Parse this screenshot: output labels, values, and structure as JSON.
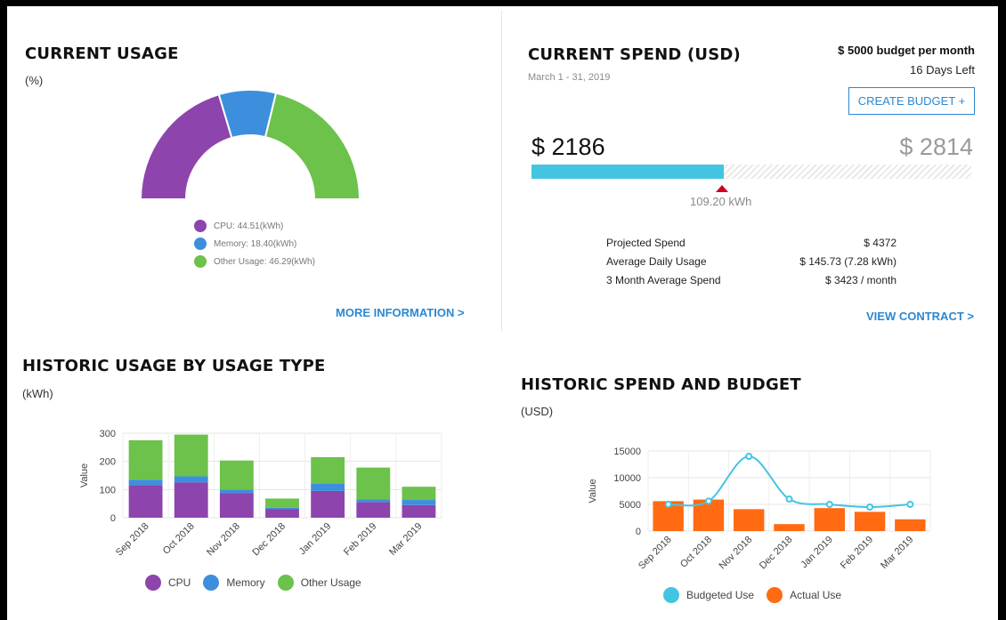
{
  "current_usage": {
    "title": "CURRENT USAGE",
    "unit": "(%)",
    "legend": [
      {
        "label": "CPU: 44.51(kWh)",
        "color": "#8e44ad"
      },
      {
        "label": "Memory: 18.40(kWh)",
        "color": "#3d8fdd"
      },
      {
        "label": "Other Usage: 46.29(kWh)",
        "color": "#6cc24a"
      }
    ],
    "link": "MORE INFORMATION >"
  },
  "current_spend": {
    "title": "CURRENT SPEND (USD)",
    "date_range": "March 1 - 31, 2019",
    "budget_text": "$ 5000 budget per month",
    "days_left": "16 Days Left",
    "create_budget": "CREATE BUDGET +",
    "spent": "$ 2186",
    "remaining": "$ 2814",
    "spent_fraction": 0.4372,
    "marker_label": "109.20 kWh",
    "stats": [
      {
        "label": "Projected Spend",
        "value": "$ 4372"
      },
      {
        "label": "Average Daily Usage",
        "value": "$ 145.73 (7.28 kWh)"
      },
      {
        "label": "3 Month Average Spend",
        "value": "$ 3423 / month"
      }
    ],
    "link": "VIEW CONTRACT >"
  },
  "historic_usage": {
    "title": "HISTORIC USAGE BY USAGE TYPE",
    "unit": "(kWh)",
    "legend": [
      {
        "label": "CPU",
        "color": "#8e44ad"
      },
      {
        "label": "Memory",
        "color": "#3d8fdd"
      },
      {
        "label": "Other Usage",
        "color": "#6cc24a"
      }
    ]
  },
  "historic_spend": {
    "title": "HISTORIC SPEND AND BUDGET",
    "unit": "(USD)",
    "legend": [
      {
        "label": "Budgeted Use",
        "color": "#43c5e2"
      },
      {
        "label": "Actual Use",
        "color": "#ff6a13"
      }
    ]
  },
  "chart_data": [
    {
      "type": "pie",
      "categories": [
        "CPU",
        "Memory",
        "Other Usage"
      ],
      "values": [
        44.51,
        18.4,
        46.29
      ],
      "title": "CURRENT USAGE"
    },
    {
      "type": "bar",
      "title": "HISTORIC USAGE BY USAGE TYPE",
      "categories": [
        "Sep 2018",
        "Oct 2018",
        "Nov 2018",
        "Dec 2018",
        "Jan 2019",
        "Feb 2019",
        "Mar 2019"
      ],
      "series": [
        {
          "name": "CPU",
          "values": [
            115,
            125,
            88,
            30,
            95,
            55,
            45
          ]
        },
        {
          "name": "Memory",
          "values": [
            20,
            22,
            12,
            5,
            25,
            10,
            18
          ]
        },
        {
          "name": "Other Usage",
          "values": [
            140,
            148,
            103,
            33,
            95,
            113,
            47
          ]
        }
      ],
      "ylabel": "Value",
      "ylim": [
        0,
        300
      ],
      "yticks": [
        0,
        100,
        200,
        300
      ],
      "grid": true
    },
    {
      "type": "bar",
      "title": "HISTORIC SPEND AND BUDGET",
      "categories": [
        "Sep 2018",
        "Oct 2018",
        "Nov 2018",
        "Dec 2018",
        "Jan 2019",
        "Feb 2019",
        "Mar 2019"
      ],
      "series": [
        {
          "name": "Actual Use",
          "type": "bar",
          "values": [
            5600,
            5900,
            4100,
            1300,
            4300,
            3600,
            2200
          ]
        },
        {
          "name": "Budgeted Use",
          "type": "line",
          "values": [
            5000,
            5600,
            14000,
            6000,
            5000,
            4500,
            5000
          ]
        }
      ],
      "ylabel": "Value",
      "ylim": [
        0,
        15000
      ],
      "yticks": [
        0,
        5000,
        10000,
        15000
      ],
      "grid": true
    }
  ]
}
